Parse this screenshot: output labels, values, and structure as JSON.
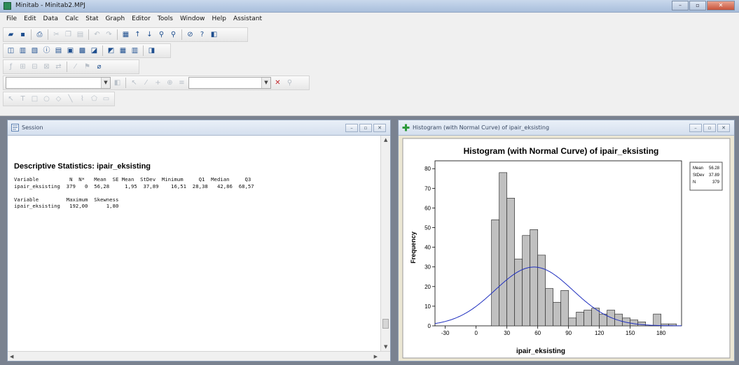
{
  "app": {
    "title": "Minitab - Minitab2.MPJ"
  },
  "menu": [
    "File",
    "Edit",
    "Data",
    "Calc",
    "Stat",
    "Graph",
    "Editor",
    "Tools",
    "Window",
    "Help",
    "Assistant"
  ],
  "session": {
    "title": "Session",
    "heading": "Descriptive Statistics: ipair_eksisting",
    "output": "Variable          N  N*   Mean  SE Mean  StDev  Minimum     Q1  Median     Q3\nipair_eksisting  379   0  56,28     1,95  37,89    16,51  28,38   42,86  68,57\n\nVariable         Maximum  Skewness\nipair_eksisting   192,00      1,80"
  },
  "graph": {
    "window_title": "Histogram (with Normal Curve) of ipair_eksisting",
    "legend": {
      "rows": [
        {
          "label": "Mean",
          "value": "56.28"
        },
        {
          "label": "StDev",
          "value": "37.89"
        },
        {
          "label": "N",
          "value": "379"
        }
      ]
    },
    "colors": {
      "bar_fill": "#c0c0c0",
      "bar_stroke": "#333333",
      "curve": "#1f2fbf",
      "frame_bg": "#ece7d4"
    }
  },
  "chart_data": {
    "type": "bar",
    "title": "Histogram (with Normal Curve) of ipair_eksisting",
    "xlabel": "ipair_eksisting",
    "ylabel": "Frequency",
    "xlim": [
      -40,
      200
    ],
    "ylim": [
      0,
      84
    ],
    "x_ticks": [
      -30,
      0,
      30,
      60,
      90,
      120,
      150,
      180
    ],
    "y_ticks": [
      0,
      10,
      20,
      30,
      40,
      50,
      60,
      70,
      80
    ],
    "bin_width": 7.5,
    "bins": [
      {
        "x0": 15,
        "value": 54
      },
      {
        "x0": 22.5,
        "value": 78
      },
      {
        "x0": 30,
        "value": 65
      },
      {
        "x0": 37.5,
        "value": 34
      },
      {
        "x0": 45,
        "value": 46
      },
      {
        "x0": 52.5,
        "value": 49
      },
      {
        "x0": 60,
        "value": 36
      },
      {
        "x0": 67.5,
        "value": 19
      },
      {
        "x0": 75,
        "value": 12
      },
      {
        "x0": 82.5,
        "value": 18
      },
      {
        "x0": 90,
        "value": 4
      },
      {
        "x0": 97.5,
        "value": 7
      },
      {
        "x0": 105,
        "value": 8
      },
      {
        "x0": 112.5,
        "value": 9
      },
      {
        "x0": 120,
        "value": 6
      },
      {
        "x0": 127.5,
        "value": 8
      },
      {
        "x0": 135,
        "value": 6
      },
      {
        "x0": 142.5,
        "value": 4
      },
      {
        "x0": 150,
        "value": 3
      },
      {
        "x0": 157.5,
        "value": 2
      },
      {
        "x0": 172.5,
        "value": 6
      },
      {
        "x0": 180,
        "value": 1
      },
      {
        "x0": 187.5,
        "value": 1
      }
    ],
    "normal_curve": {
      "mean": 56.28,
      "stdev": 37.89,
      "n": 379
    },
    "grid": false,
    "legend_position": "top-right"
  }
}
